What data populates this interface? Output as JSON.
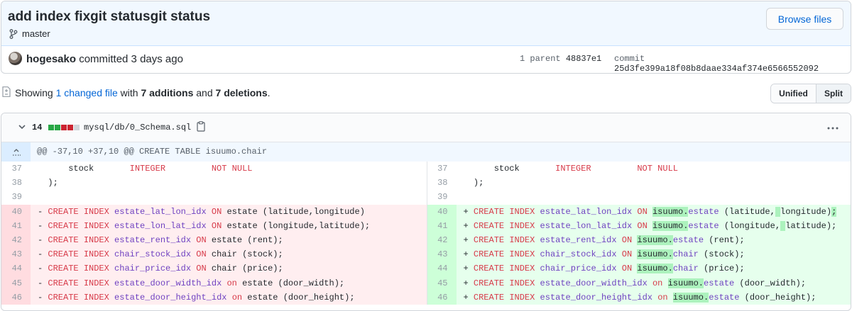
{
  "commit": {
    "title": "add index fixgit statusgit status",
    "branch": "master",
    "browse_files": "Browse files",
    "author": "hogesako",
    "committed_text": "committed 3 days ago",
    "parent_label": "1 parent",
    "parent_sha": "48837e1",
    "commit_label": "commit",
    "commit_sha": "25d3fe399a18f08b8daae334af374e6566552092"
  },
  "toc": {
    "showing": "Showing",
    "changed_link": "1 changed file",
    "with": "with",
    "additions": "7 additions",
    "and": "and",
    "deletions": "7 deletions",
    "end": ".",
    "unified": "Unified",
    "split": "Split"
  },
  "file": {
    "count": "14",
    "name": "mysql/db/0_Schema.sql",
    "hunk": "@@ -37,10 +37,10 @@ CREATE TABLE isuumo.chair"
  },
  "colors": {
    "addition": "#28a745",
    "deletion": "#cb2431",
    "neutral": "#d1d5da",
    "link": "#0366d6"
  }
}
